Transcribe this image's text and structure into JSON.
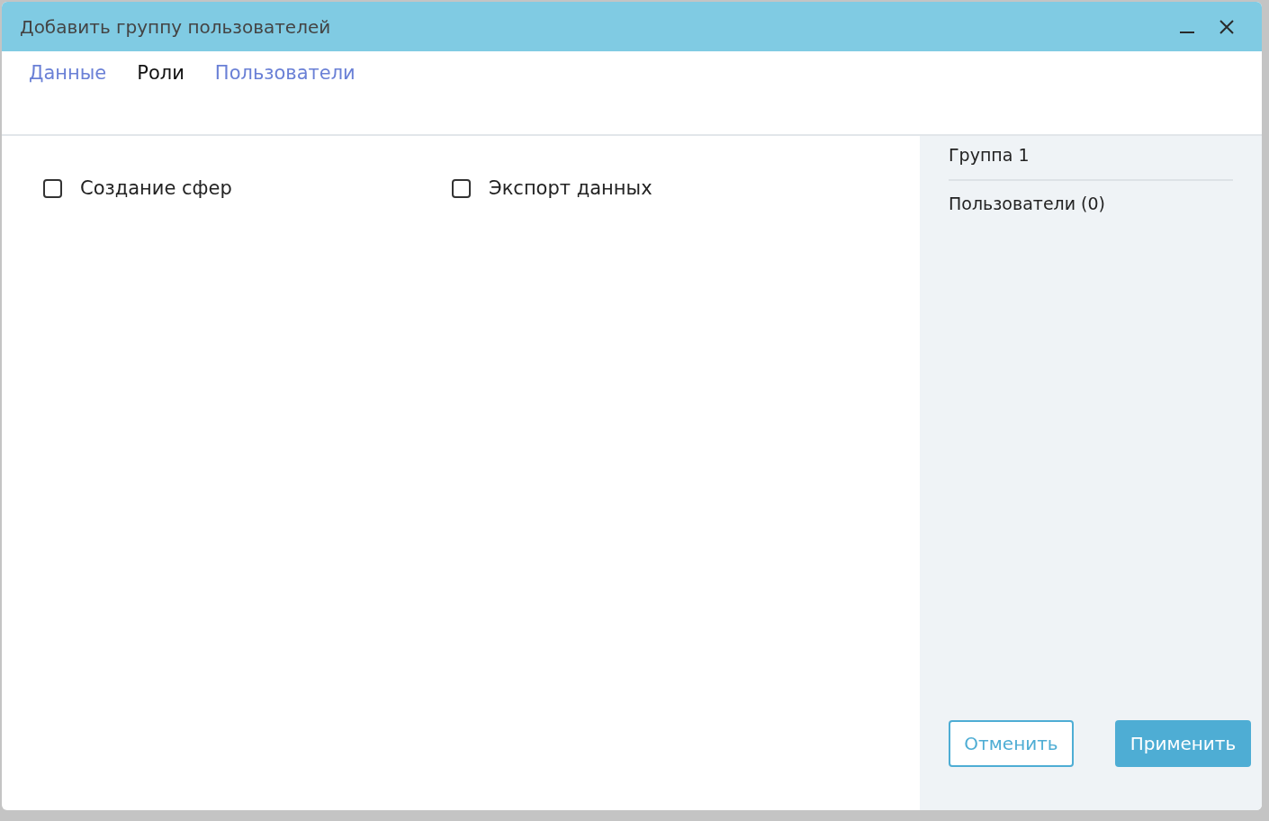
{
  "window": {
    "title": "Добавить группу пользователей"
  },
  "tabs": [
    {
      "label": "Данные",
      "selected": false
    },
    {
      "label": "Роли",
      "selected": true
    },
    {
      "label": "Пользователи",
      "selected": false
    }
  ],
  "permissions": [
    {
      "label": "Создание сфер",
      "checked": false
    },
    {
      "label": "Экспорт данных",
      "checked": false
    }
  ],
  "summary": {
    "group_name": "Группа 1",
    "users": "Пользователи (0)"
  },
  "buttons": [
    {
      "label": "Отменить",
      "kind": "secondary"
    },
    {
      "label": "Применить",
      "kind": "primary"
    }
  ]
}
